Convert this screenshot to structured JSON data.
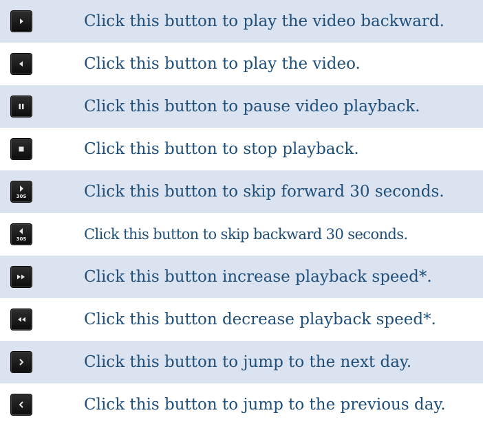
{
  "rows": [
    {
      "icon": "play-backward-icon",
      "text": "Click this button to play the video backward."
    },
    {
      "icon": "play-icon",
      "text": "Click this button to play the video."
    },
    {
      "icon": "pause-icon",
      "text": "Click this button to pause video playback."
    },
    {
      "icon": "stop-icon",
      "text": "Click this button to stop playback."
    },
    {
      "icon": "skip-forward-30s-icon",
      "text": "Click this button to skip forward 30 seconds.",
      "icon_label": "30S"
    },
    {
      "icon": "skip-backward-30s-icon",
      "text": "Click this button to skip backward 30 seconds.",
      "icon_label": "30S"
    },
    {
      "icon": "fast-forward-icon",
      "text": "Click this button increase playback speed*."
    },
    {
      "icon": "rewind-icon",
      "text": "Click this button decrease playback speed*."
    },
    {
      "icon": "next-day-icon",
      "text": "Click this button to jump to the next day."
    },
    {
      "icon": "previous-day-icon",
      "text": "Click this button to jump to the previous day."
    }
  ],
  "colors": {
    "row_shade": "#dbe3f1",
    "text": "#1f4e79",
    "button_bg": "#1a1a1a",
    "glyph": "#e6e6e6"
  }
}
